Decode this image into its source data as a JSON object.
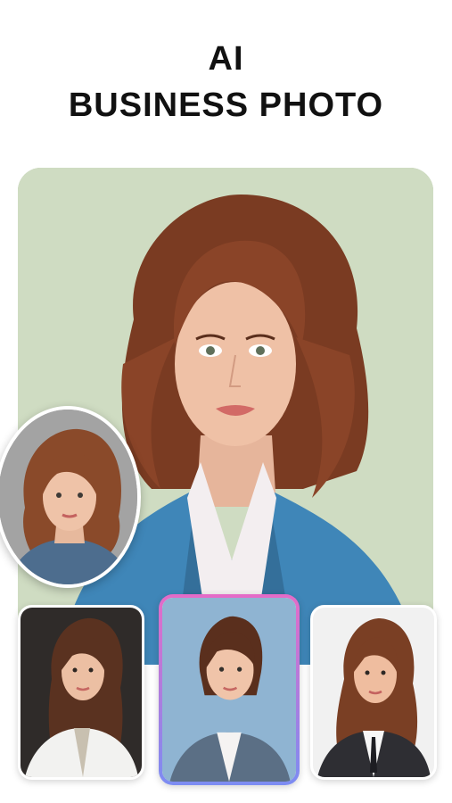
{
  "headline": {
    "line1": "AI",
    "line2": "BUSINESS PHOTO"
  },
  "colors": {
    "hero_background": "#cfdcc2",
    "accent_gradient_top": "#e56bc7",
    "accent_gradient_bottom": "#7c8cf2",
    "blazer_blue": "#3f86b8"
  },
  "images": {
    "hero": "woman-blue-blazer-portrait",
    "original": "woman-denim-shirt-portrait",
    "styles": [
      "dark-studio-portrait",
      "blue-background-portrait",
      "white-background-portrait"
    ]
  }
}
